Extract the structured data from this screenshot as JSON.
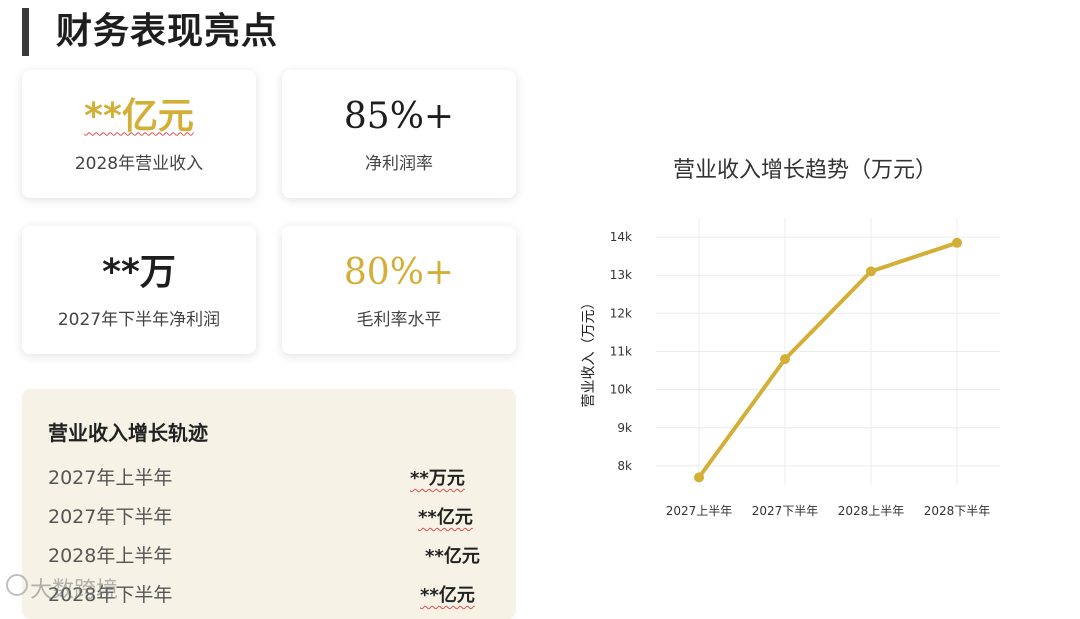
{
  "page": {
    "title": "财务表现亮点"
  },
  "cards": [
    {
      "value": "**亿元",
      "label": "2028年营业收入"
    },
    {
      "value": "85%+",
      "label": "净利润率"
    },
    {
      "value": "**万",
      "label": "2027年下半年净利润"
    },
    {
      "value": "80%+",
      "label": "毛利率水平"
    }
  ],
  "track": {
    "title": "营业收入增长轨迹",
    "rows": [
      {
        "label": "2027年上半年",
        "value": "**万元"
      },
      {
        "label": "2027年下半年",
        "value": "**亿元"
      },
      {
        "label": "2028年上半年",
        "value": "**亿元"
      },
      {
        "label": "2028年下半年",
        "value": "**亿元"
      }
    ]
  },
  "watermark": "大数跨境",
  "colors": {
    "gold": "#d4af37",
    "dark": "#1e1e1e",
    "panel": "#f7f2e6"
  },
  "chart_data": {
    "type": "line",
    "title": "营业收入增长趋势（万元）",
    "xlabel": "",
    "ylabel": "营业收入（万元）",
    "categories": [
      "2027上半年",
      "2027下半年",
      "2028上半年",
      "2028下半年"
    ],
    "series": [
      {
        "values": [
          7700,
          10800,
          13100,
          13850
        ]
      }
    ],
    "yticks": [
      "8k",
      "9k",
      "10k",
      "11k",
      "12k",
      "13k",
      "14k"
    ],
    "ylim": [
      7500,
      14500
    ],
    "grid": true,
    "color": "#d4af37"
  }
}
